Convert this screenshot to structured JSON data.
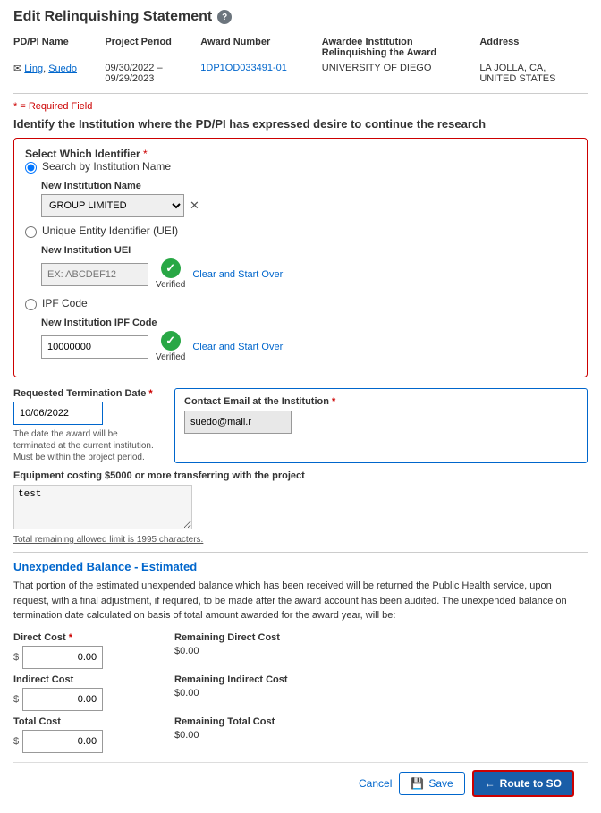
{
  "page": {
    "title": "Edit Relinquishing Statement",
    "help_icon": "?",
    "required_note": "* = Required Field"
  },
  "info_row": {
    "headers": [
      "PD/PI Name",
      "Project Period",
      "Award Number",
      "Awardee Institution\nRelinquishing the Award",
      "Address"
    ],
    "pi_email_icon": "✉",
    "pi_name_first": "Ling",
    "pi_name_comma": ",",
    "pi_name_last": "Suedo",
    "project_period": "09/30/2022 –\n09/29/2023",
    "award_number": "1DP1OD033491-01",
    "awardee_institution": "UNIVERSITY OF DIEGO",
    "address": "LA JOLLA, CA,\nUNITED STATES"
  },
  "identify_section": {
    "heading": "Identify the Institution where the PD/PI has expressed desire to continue the research"
  },
  "identifier_box": {
    "title": "Select Which Identifier",
    "options": [
      {
        "id": "search-by-institution",
        "label": "Search by Institution Name",
        "selected": true,
        "sub_label": "New Institution Name",
        "value": "GROUP LIMITED",
        "type": "select"
      },
      {
        "id": "uei",
        "label": "Unique Entity Identifier (UEI)",
        "selected": false,
        "sub_label": "New Institution UEI",
        "placeholder": "EX: ABCDEF12",
        "value": "",
        "type": "input",
        "verified": true,
        "verified_label": "Verified",
        "clear_label": "Clear and Start Over"
      },
      {
        "id": "ipf",
        "label": "IPF Code",
        "selected": false,
        "sub_label": "New Institution IPF Code",
        "value": "10000000",
        "type": "input",
        "verified": true,
        "verified_label": "Verified",
        "clear_label": "Clear and Start Over"
      }
    ]
  },
  "termination": {
    "label": "Requested Termination Date",
    "value": "10/06/2022",
    "note": "The date the award will be terminated at the current institution. Must be within the project period."
  },
  "contact_email": {
    "label": "Contact Email at the Institution",
    "value": "suedo@mail.r"
  },
  "equipment": {
    "label": "Equipment costing $5000 or more transferring with the project",
    "value": "test",
    "char_remaining": "1995",
    "char_note_pre": "Total remaining allowed limit is ",
    "char_note_post": " characters."
  },
  "unexpended": {
    "title": "Unexpended Balance - Estimated",
    "text": "That portion of the estimated unexpended balance which has been received will be returned the Public Health service, upon request, with a final adjustment, if required, to be made after the award account has been audited. The unexpended balance on termination date calculated on basis of total amount awarded for the award year, will be:"
  },
  "costs": {
    "direct": {
      "label": "Direct Cost",
      "required": true,
      "value": "0.00",
      "remaining_label": "Remaining Direct Cost",
      "remaining_value": "$0.00"
    },
    "indirect": {
      "label": "Indirect Cost",
      "required": false,
      "value": "0.00",
      "remaining_label": "Remaining Indirect Cost",
      "remaining_value": "$0.00"
    },
    "total": {
      "label": "Total Cost",
      "required": false,
      "value": "0.00",
      "remaining_label": "Remaining Total Cost",
      "remaining_value": "$0.00"
    }
  },
  "footer": {
    "cancel_label": "Cancel",
    "save_icon": "💾",
    "save_label": "Save",
    "route_arrow": "←",
    "route_label": "Route to SO"
  }
}
